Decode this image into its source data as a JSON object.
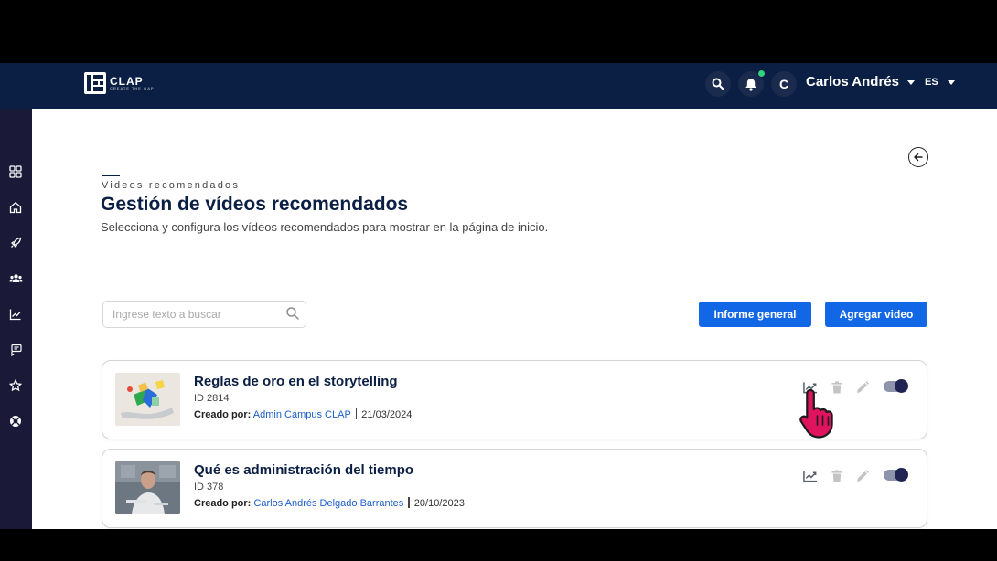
{
  "app": {
    "logo_name": "CLAP",
    "logo_tag": "CREATE THE GAP"
  },
  "header": {
    "user_initial": "C",
    "user_name": "Carlos Andrés",
    "language": "ES"
  },
  "sidebar": {
    "items": [
      "grid-icon",
      "home-icon",
      "rocket-icon",
      "users-icon",
      "chart-icon",
      "chat-icon",
      "star-icon",
      "lifebuoy-icon"
    ]
  },
  "page": {
    "eyebrow": "Videos recomendados",
    "title": "Gestión de vídeos recomendados",
    "subtitle": "Selecciona y configura los vídeos recomendados para mostrar en la página de inicio."
  },
  "toolbar": {
    "search_placeholder": "Ingrese texto a buscar",
    "report_label": "Informe general",
    "add_label": "Agregar video"
  },
  "videos": [
    {
      "title": "Reglas de oro en el storytelling",
      "id": "ID 2814",
      "created_label": "Creado por:",
      "author": "Admin Campus CLAP",
      "date": "21/03/2024",
      "active": true
    },
    {
      "title": "Qué es administración del tiempo",
      "id": "ID 378",
      "created_label": "Creado por:",
      "author": "Carlos Andrés Delgado Barrantes",
      "date": "20/10/2023",
      "active": true
    }
  ],
  "colors": {
    "navy": "#0b1f44",
    "primary": "#1167e6",
    "sidebar": "#1a1a38",
    "toggle_on": "#1f2452",
    "notification_dot": "#35d07f",
    "cursor": "#e0135f"
  }
}
